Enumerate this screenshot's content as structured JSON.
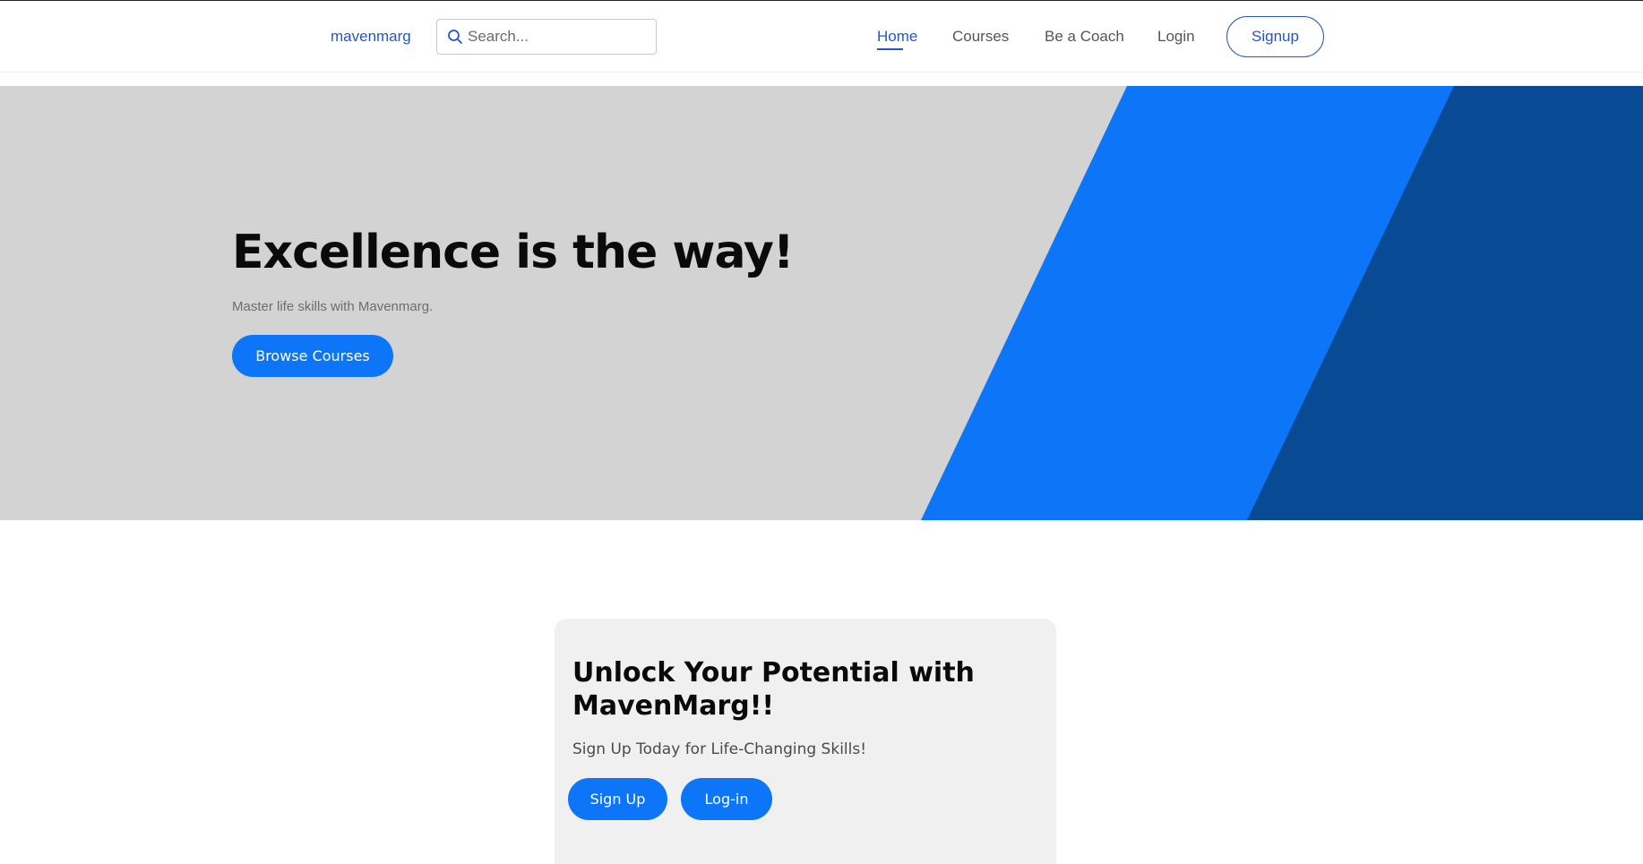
{
  "navbar": {
    "brand": "mavenmarg",
    "search_placeholder": "Search...",
    "links": {
      "home": "Home",
      "courses": "Courses",
      "coach": "Be a Coach",
      "login": "Login"
    },
    "signup": "Signup"
  },
  "hero": {
    "title": "Excellence is the way!",
    "subtitle": "Master life skills with Mavenmarg.",
    "button": "Browse Courses"
  },
  "cta": {
    "title": "Unlock Your Potential with MavenMarg!!",
    "subtitle": "Sign Up Today for Life-Changing Skills!",
    "signup_button": "Sign Up",
    "login_button": "Log-in"
  },
  "colors": {
    "accent": "#0d76f8",
    "accent_dark": "#084a93",
    "link": "#2457c5",
    "hero_bg": "#d3d3d3",
    "card_bg": "#f0f0f0"
  },
  "icons": {
    "search": "search-icon"
  }
}
